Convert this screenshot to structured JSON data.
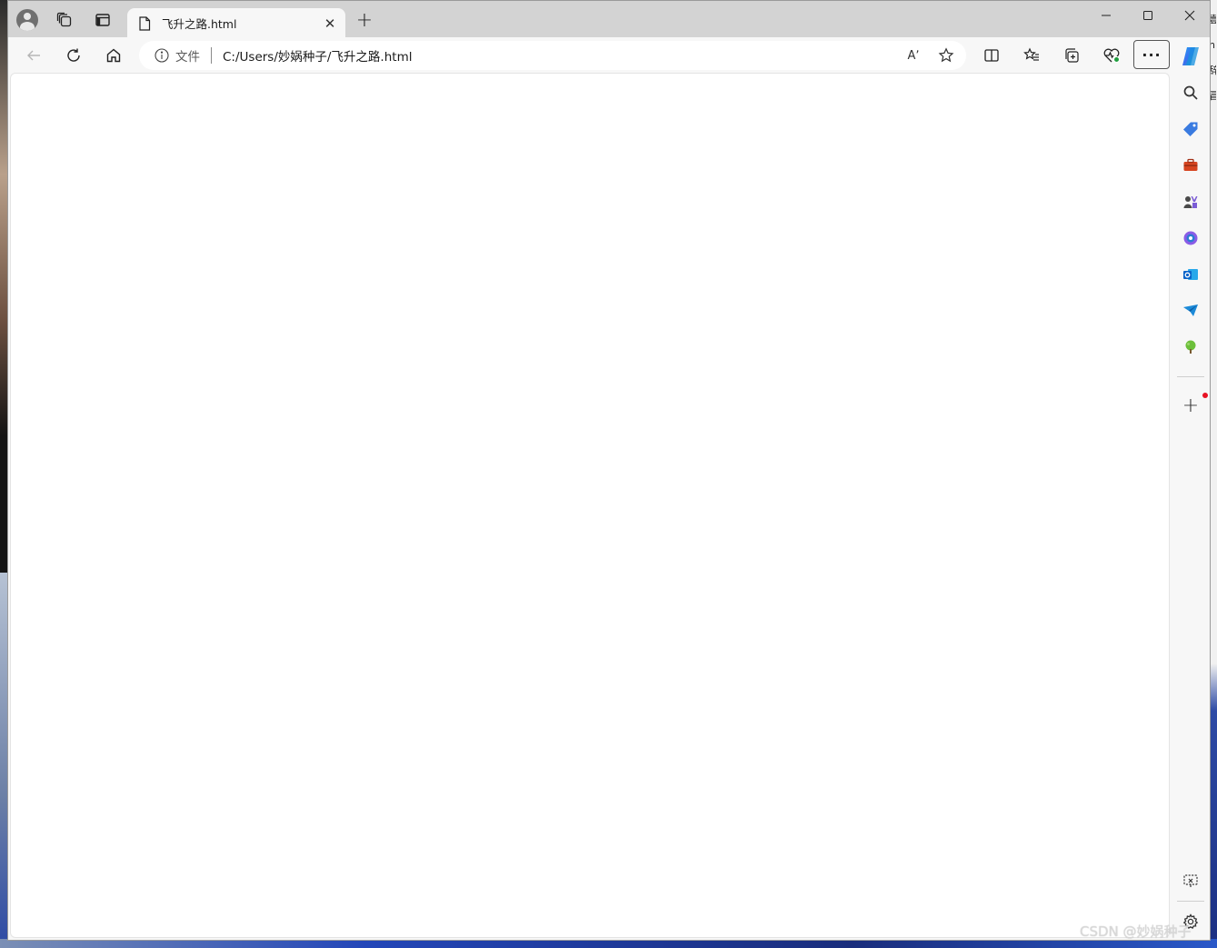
{
  "tab": {
    "title": "飞升之路.html",
    "close_glyph": "✕"
  },
  "newtab": {
    "glyph": "+"
  },
  "addressbar": {
    "scheme_label": "文件",
    "url": "C:/Users/妙娲种子/飞升之路.html"
  },
  "toolbar": {
    "more_glyph": "···",
    "read_aloud_glyph": "Aʼ"
  },
  "sidebar": {
    "items": [
      "copilot-icon",
      "search-icon",
      "shopping-tag-icon",
      "tools-icon",
      "games-icon",
      "office-icon",
      "outlook-icon",
      "send-icon",
      "tree-icon"
    ],
    "add_glyph": "+"
  },
  "desktop": {
    "right_edge_text": "壹 nl 辞 冒"
  },
  "watermark": "CSDN @妙娲种子",
  "colors": {
    "titlebar": "#d3d3d3",
    "toolbar": "#f7f7f7",
    "content": "#ffffff",
    "accent_red": "#e81123"
  }
}
